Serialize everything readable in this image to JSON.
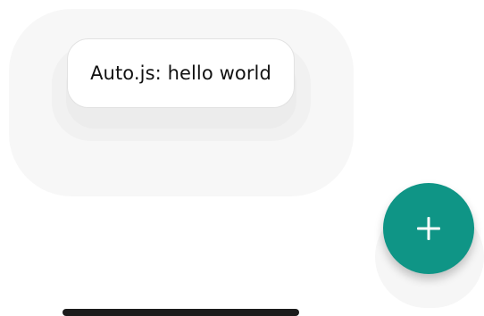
{
  "toast": {
    "message": "Auto.js: hello world"
  },
  "fab": {
    "icon": "plus-icon",
    "color": "#0f9586"
  },
  "colors": {
    "background": "#ffffff",
    "toast_text": "#111111",
    "home_indicator": "#1c1c1c"
  }
}
